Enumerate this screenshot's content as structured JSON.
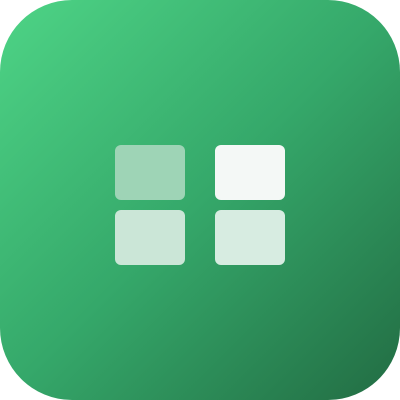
{
  "icon": {
    "name": "grid-app-icon",
    "glyph": "four-square-grid-icon"
  },
  "colors": {
    "gradient_start": "#4ed486",
    "gradient_mid": "#35a86a",
    "gradient_end": "#226c43",
    "cell_top_left": "#9ed4b6",
    "cell_top_right": "#f4f8f6",
    "cell_bottom_left": "#cbe6d7",
    "cell_bottom_right": "#d7ece1"
  }
}
